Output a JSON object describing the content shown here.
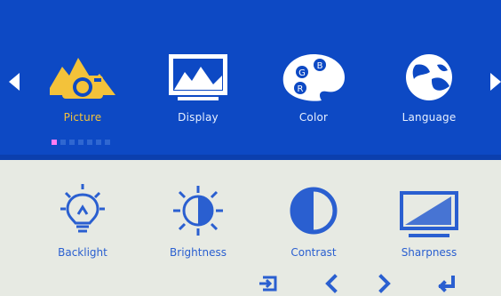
{
  "menu": {
    "items": [
      {
        "label": "Picture"
      },
      {
        "label": "Display"
      },
      {
        "label": "Color"
      },
      {
        "label": "Language"
      }
    ],
    "selected_index": 0,
    "icons": [
      "picture-icon",
      "display-icon",
      "color-icon",
      "language-icon"
    ]
  },
  "page_indicator": {
    "count": 7,
    "active_index": 0,
    "active_color": "#ff7cf3"
  },
  "sub_menu": {
    "items": [
      {
        "label": "Backlight"
      },
      {
        "label": "Brightness"
      },
      {
        "label": "Contrast"
      },
      {
        "label": "Sharpness"
      }
    ],
    "icons": [
      "backlight-icon",
      "brightness-icon",
      "contrast-icon",
      "sharpness-icon"
    ]
  },
  "color_wheel": {
    "letters": [
      "B",
      "G",
      "R"
    ]
  },
  "nav": {
    "icons": [
      "exit-icon",
      "left-icon",
      "right-icon",
      "enter-icon"
    ]
  },
  "colors": {
    "top_band": "#0d49c4",
    "bottom_band": "#e7eae3",
    "selected": "#f3c23a",
    "label": "#e7f0ff",
    "sub_label": "#2a5fd0"
  }
}
